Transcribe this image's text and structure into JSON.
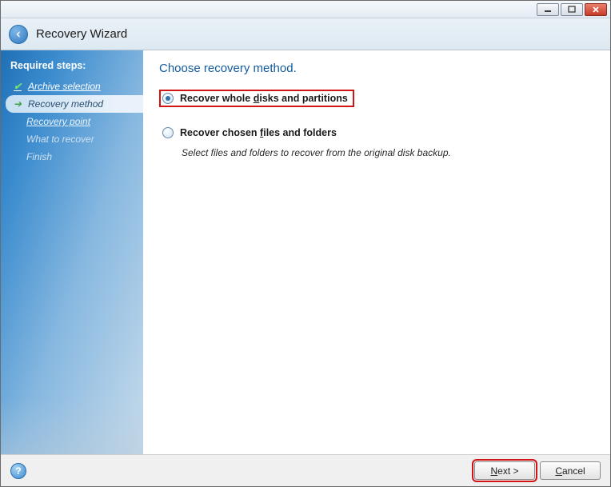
{
  "window": {
    "title": "Recovery Wizard"
  },
  "sidebar": {
    "heading": "Required steps:",
    "items": [
      {
        "label": "Archive selection",
        "state": "completed"
      },
      {
        "label": "Recovery method",
        "state": "current"
      },
      {
        "label": "Recovery point",
        "state": "pending-link"
      },
      {
        "label": "What to recover",
        "state": "pending"
      },
      {
        "label": "Finish",
        "state": "pending"
      }
    ]
  },
  "content": {
    "title": "Choose recovery method.",
    "options": [
      {
        "label_pre": "Recover whole ",
        "label_u": "d",
        "label_post": "isks and partitions",
        "selected": true,
        "highlighted": true,
        "desc": ""
      },
      {
        "label_pre": "Recover chosen ",
        "label_u": "f",
        "label_post": "iles and folders",
        "selected": false,
        "highlighted": false,
        "desc": "Select files and folders to recover from the original disk backup."
      }
    ]
  },
  "footer": {
    "help": "?",
    "next_u": "N",
    "next_post": "ext >",
    "cancel_u": "C",
    "cancel_post": "ancel"
  }
}
